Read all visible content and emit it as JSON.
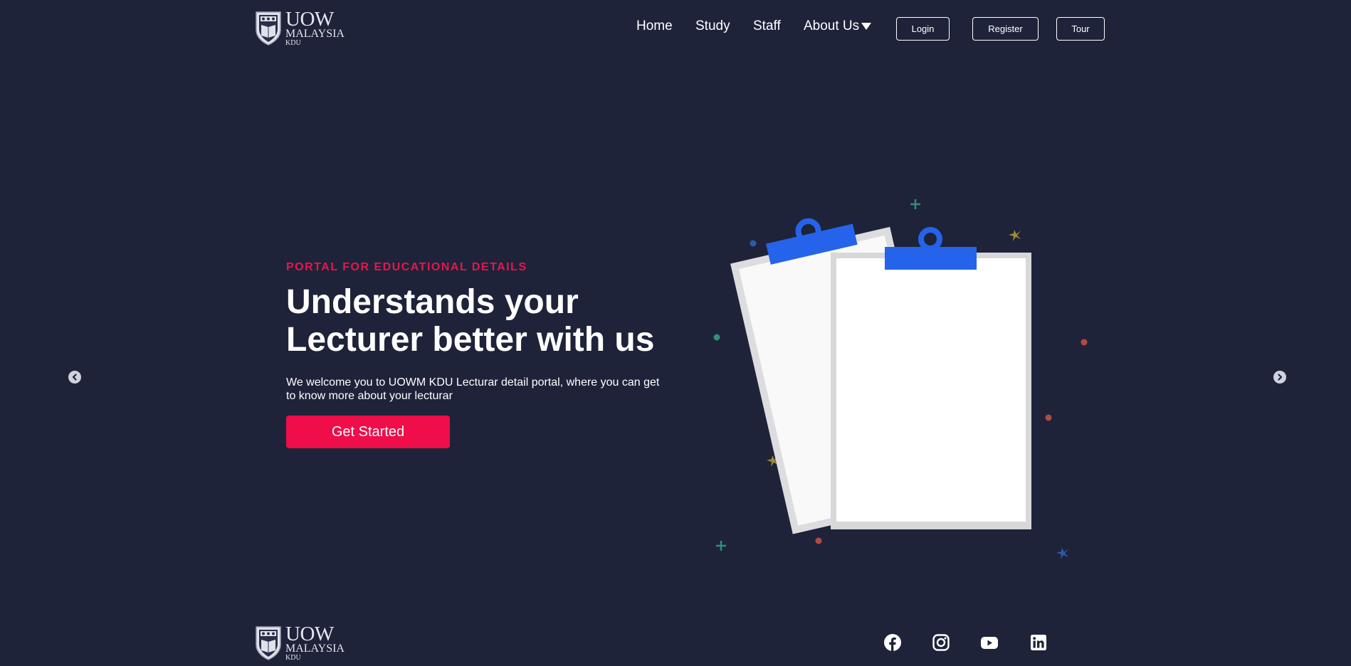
{
  "header": {
    "logo": {
      "line1": "UOW",
      "line2": "MALAYSIA",
      "line3": "KDU",
      "icon": "shield-crest-icon"
    },
    "nav": [
      {
        "label": "Home"
      },
      {
        "label": "Study"
      },
      {
        "label": "Staff"
      },
      {
        "label": "About Us",
        "icon": "caret-down-icon"
      }
    ],
    "buttons": {
      "login": "Login",
      "register": "Register",
      "tour": "Tour"
    }
  },
  "hero": {
    "eyebrow": "PORTAL FOR EDUCATIONAL DETAILS",
    "headline": "Understands your Lecturer better with us",
    "description": "We welcome you to UOWM KDU Lecturar detail portal, where you can get to know more about your lecturar",
    "cta": "Get Started",
    "illustration": "clipboards-illustration"
  },
  "carousel": {
    "prev_icon": "chevron-left-icon",
    "next_icon": "chevron-right-icon"
  },
  "footer": {
    "logo": {
      "line1": "UOW",
      "line2": "MALAYSIA",
      "line3": "KDU"
    },
    "social": [
      {
        "name": "facebook-icon"
      },
      {
        "name": "instagram-icon"
      },
      {
        "name": "youtube-icon"
      },
      {
        "name": "linkedin-icon"
      }
    ]
  },
  "colors": {
    "background": "#1e233a",
    "accent": "#ef0d4a",
    "eyebrow": "#e8164b",
    "clipboard_clip": "#2563eb"
  }
}
